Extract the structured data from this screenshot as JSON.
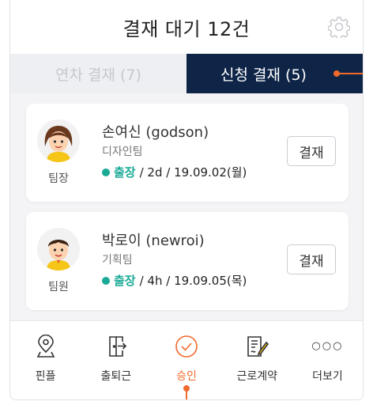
{
  "header": {
    "title": "결재 대기 12건",
    "settings_icon": "gear-icon"
  },
  "tabs": [
    {
      "label": "연차 결재 (7)",
      "active": false
    },
    {
      "label": "신청 결재 (5)",
      "active": true
    }
  ],
  "requests": [
    {
      "role": "팀장",
      "name": "손여신 (godson)",
      "team": "디자인팀",
      "type": "출장",
      "detail": " / 2d / 19.09.02(월)",
      "button": "결재",
      "avatar": "female-avatar"
    },
    {
      "role": "팀원",
      "name": "박로이 (newroi)",
      "team": "기획팀",
      "type": "출장",
      "detail": " / 4h / 19.09.05(목)",
      "button": "결재",
      "avatar": "male-avatar"
    }
  ],
  "nav": [
    {
      "label": "핀플",
      "icon": "location-pin-icon",
      "active": false
    },
    {
      "label": "출퇴근",
      "icon": "door-exit-icon",
      "active": false
    },
    {
      "label": "승인",
      "icon": "check-circle-icon",
      "active": true
    },
    {
      "label": "근로계약",
      "icon": "contract-sign-icon",
      "active": false
    },
    {
      "label": "더보기",
      "icon": "more-dots-icon",
      "active": false
    }
  ],
  "colors": {
    "accent": "#f06a2c",
    "active_tab": "#0f2548",
    "status": "#1aaa96"
  }
}
